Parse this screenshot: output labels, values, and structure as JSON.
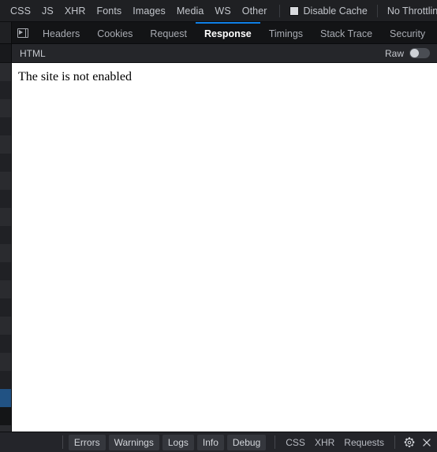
{
  "theme": {
    "accent_blue": "#0f7fe6",
    "selection_blue": "#215283",
    "toolbar_bg": "#1f2023",
    "panel_bg": "#18191c",
    "content_bg": "#ffffff",
    "text": "#c3c6cc"
  },
  "filter_toolbar": {
    "types": [
      {
        "label": "CSS"
      },
      {
        "label": "JS"
      },
      {
        "label": "XHR"
      },
      {
        "label": "Fonts"
      },
      {
        "label": "Images"
      },
      {
        "label": "Media"
      },
      {
        "label": "WS"
      },
      {
        "label": "Other"
      }
    ],
    "disable_cache": {
      "label": "Disable Cache",
      "checked": false
    },
    "throttling": {
      "value": "No Throttling",
      "stepper_up": "▴",
      "stepper_down": "▾"
    },
    "settings_icon": "gear-icon"
  },
  "detail_tabs": {
    "panel_toggle_icon": "panel-expand-icon",
    "items": [
      {
        "label": "Headers",
        "active": false
      },
      {
        "label": "Cookies",
        "active": false
      },
      {
        "label": "Request",
        "active": false
      },
      {
        "label": "Response",
        "active": true
      },
      {
        "label": "Timings",
        "active": false
      },
      {
        "label": "Stack Trace",
        "active": false
      },
      {
        "label": "Security",
        "active": false
      }
    ]
  },
  "response_header": {
    "title": "HTML",
    "raw_label": "Raw",
    "raw_enabled": false
  },
  "response_body": {
    "text": "The site is not enabled"
  },
  "request_list": {
    "row_count": 21,
    "selected_index": 18
  },
  "console_bar": {
    "filters": [
      {
        "label": "Errors",
        "style": "pill"
      },
      {
        "label": "Warnings",
        "style": "pill"
      },
      {
        "label": "Logs",
        "style": "pill"
      },
      {
        "label": "Info",
        "style": "pill"
      },
      {
        "label": "Debug",
        "style": "pill"
      }
    ],
    "categories": [
      {
        "label": "CSS"
      },
      {
        "label": "XHR"
      },
      {
        "label": "Requests"
      }
    ],
    "settings_icon": "gear-icon",
    "close_icon": "close-icon"
  }
}
